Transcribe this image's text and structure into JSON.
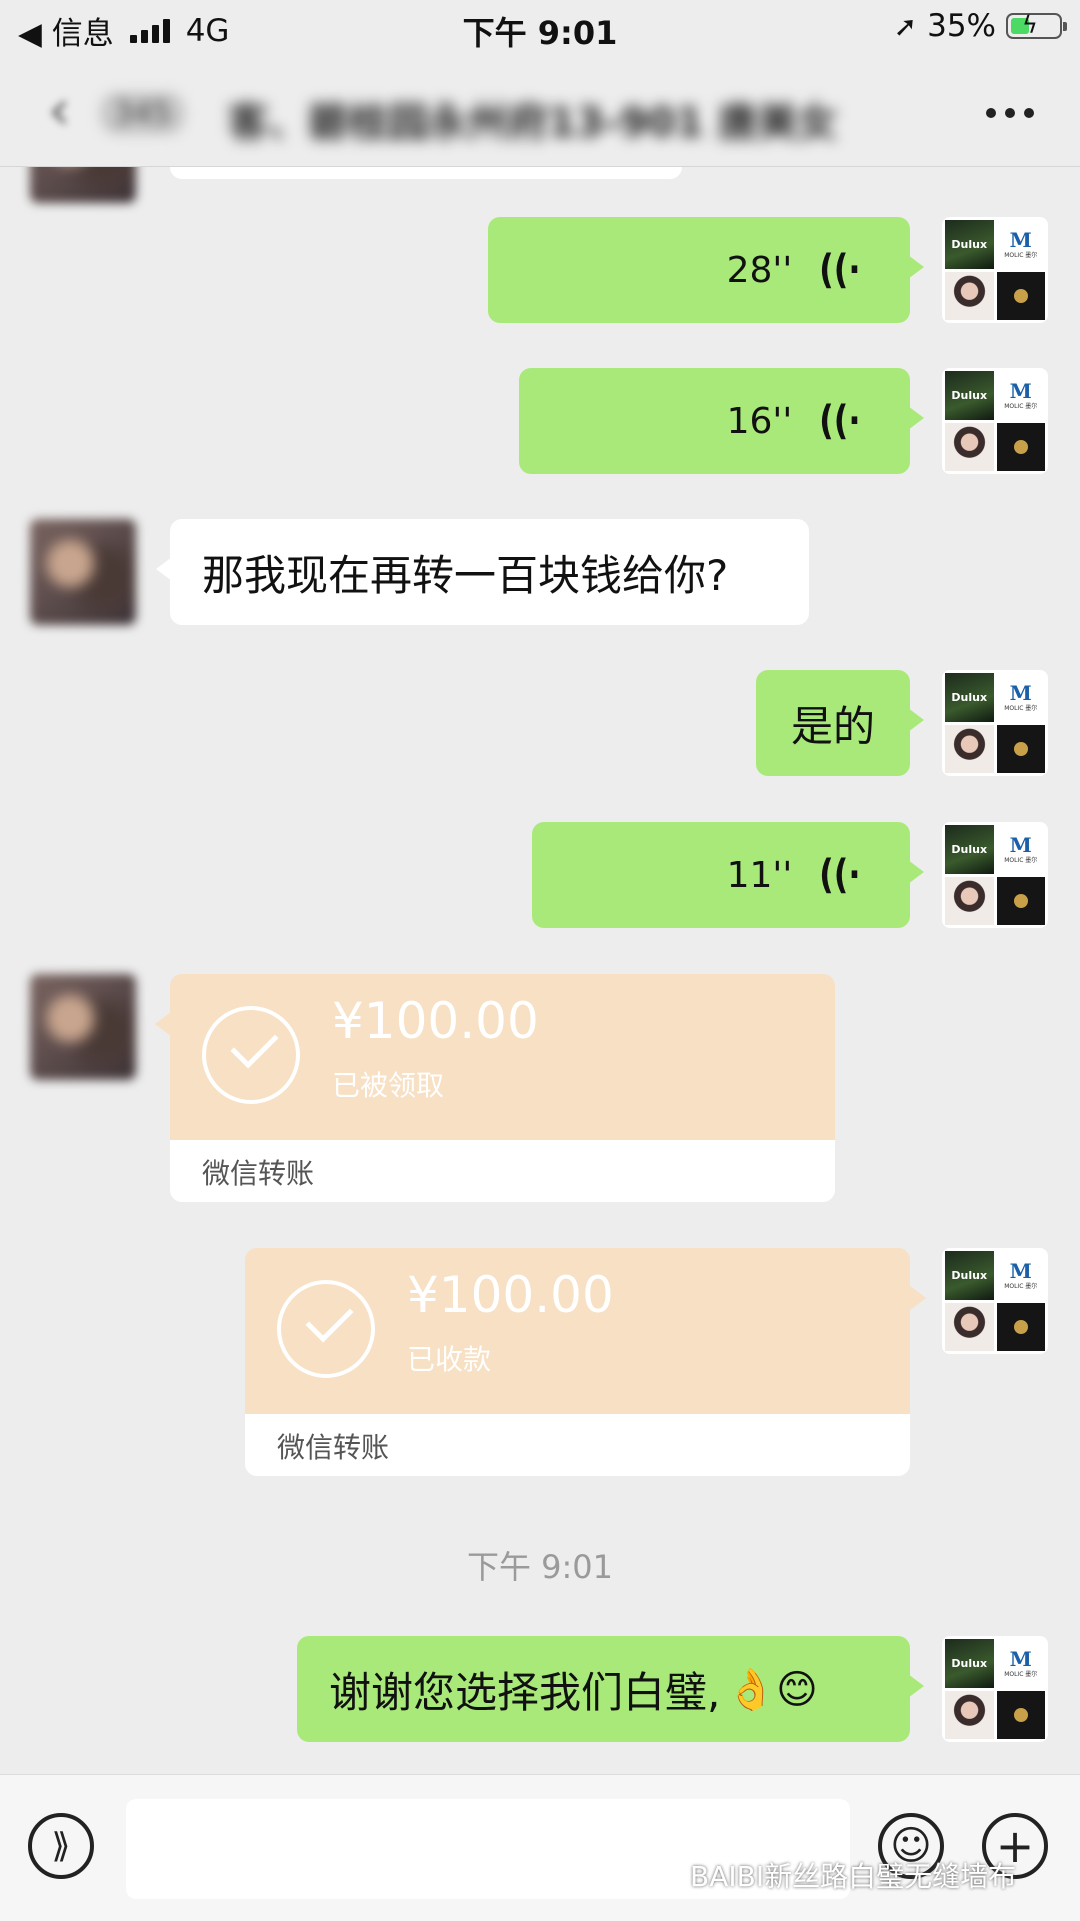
{
  "status_bar": {
    "back_label": "◀ 信息",
    "network": "4G",
    "time": "下午 9:01",
    "battery": "35%"
  },
  "nav": {
    "count": "345",
    "title": "客、碧桂园永州府13-901 唐美女",
    "more_icon": "more-icon"
  },
  "messages": {
    "m1": {
      "duration": "28''"
    },
    "m2": {
      "duration": "16''"
    },
    "m3": {
      "text": "那我现在再转一百块钱给你?"
    },
    "m4": {
      "text": "是的"
    },
    "m5": {
      "duration": "11''"
    },
    "t1": {
      "amount": "¥100.00",
      "status": "已被领取",
      "label": "微信转账"
    },
    "t2": {
      "amount": "¥100.00",
      "status": "已收款",
      "label": "微信转账"
    },
    "timestamp": "下午 9:01",
    "m6": {
      "text": "谢谢您选择我们白璧,",
      "emoji": "👌😊"
    }
  },
  "brand_avatar": {
    "q1": "Dulux",
    "q2_big": "M",
    "q2_small": "MOLIC 墨尔"
  },
  "input_bar": {
    "voice_icon": "voice-icon",
    "emoji_icon": "emoji-icon",
    "plus_icon": "plus-icon",
    "watermark": "BAIBI新丝路白璧无缝墙布"
  },
  "colors": {
    "green_bubble": "#a9e97a",
    "transfer": "#f7e0c3",
    "background": "#ededed"
  }
}
